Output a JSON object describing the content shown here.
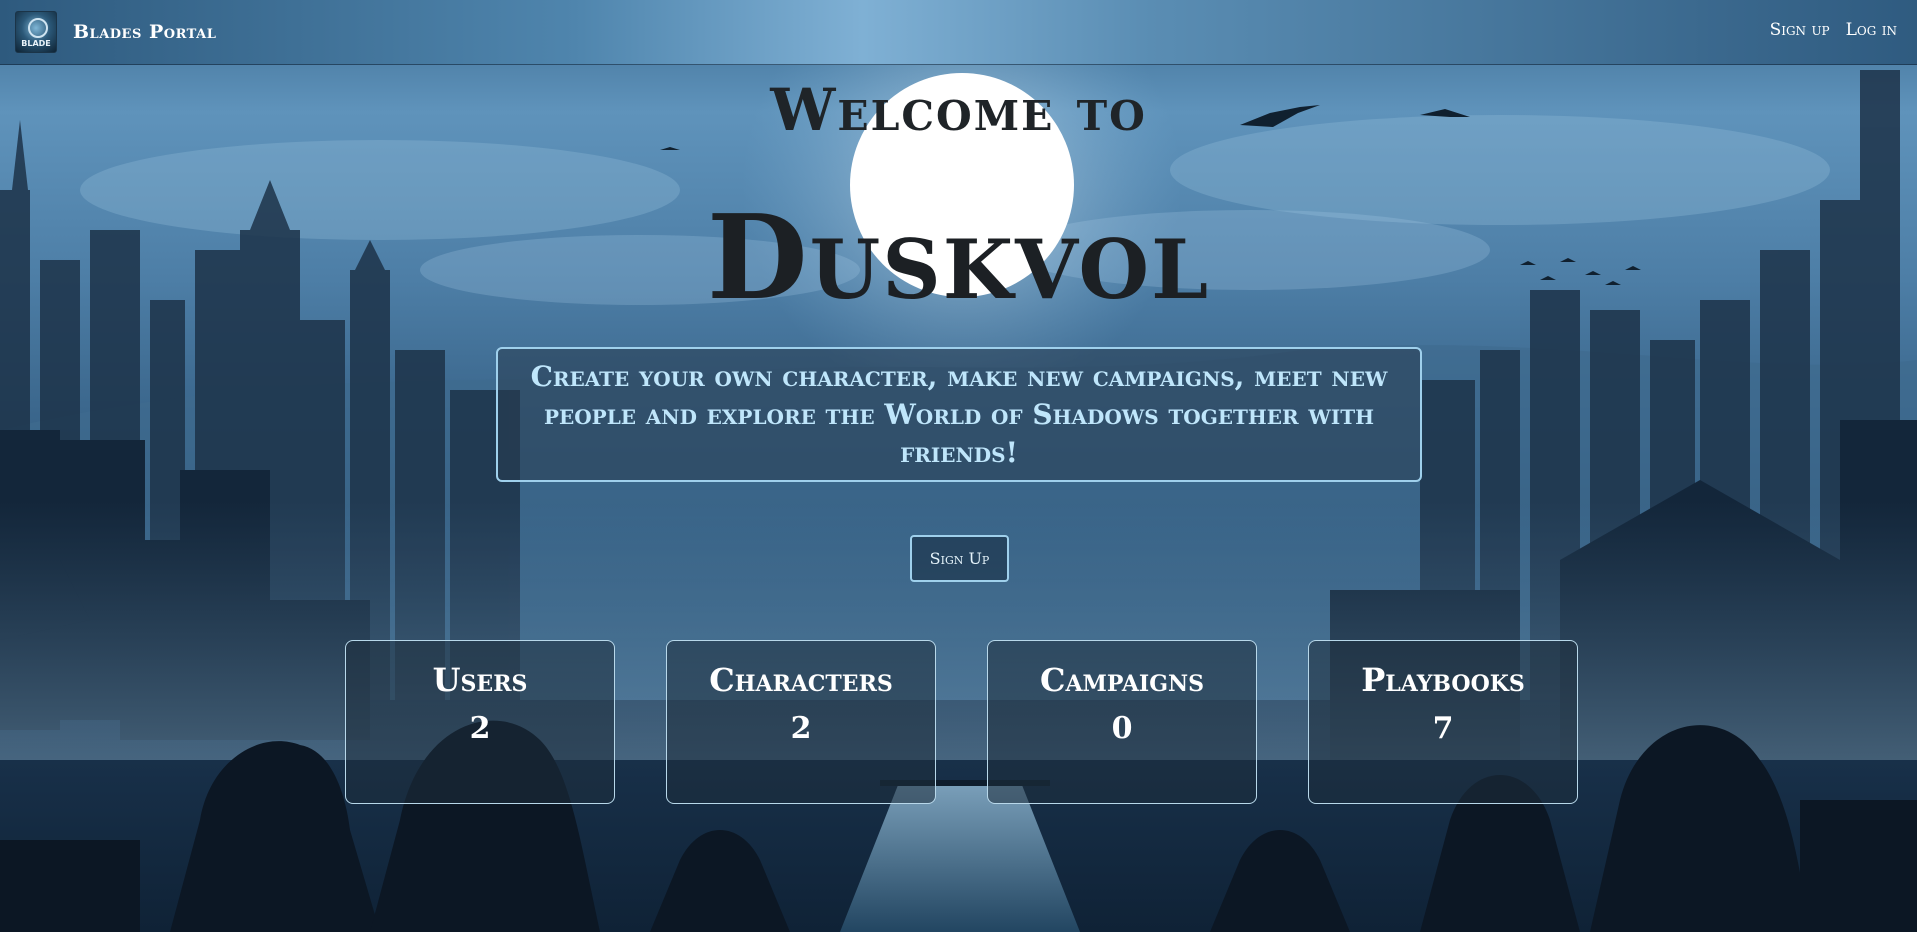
{
  "navbar": {
    "brand": "Blades Portal",
    "logo_text": "BLADE",
    "links": {
      "signup": "Sign up",
      "login": "Log in"
    }
  },
  "hero": {
    "welcome": "Welcome to",
    "city": "Duskvol",
    "tagline": "Create your own character, make new campaigns, meet new people and explore the World of Shadows together with friends!",
    "signup_button": "Sign Up"
  },
  "stats": [
    {
      "label": "Users",
      "value": "2"
    },
    {
      "label": "Characters",
      "value": "2"
    },
    {
      "label": "Campaigns",
      "value": "0"
    },
    {
      "label": "Playbooks",
      "value": "7"
    }
  ],
  "colors": {
    "accent_border": "#9fd0ec",
    "tagline_text": "#bfe6fb",
    "title_text": "#1c2024"
  }
}
